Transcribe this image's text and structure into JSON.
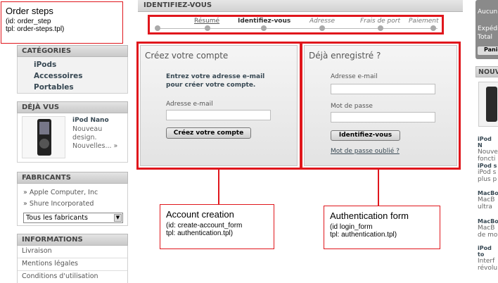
{
  "annotations": {
    "order_steps": {
      "title": "Order steps",
      "line1": "(id: order_step",
      "line2": "tpl: order-steps.tpl)"
    },
    "account_creation": {
      "title": "Account creation",
      "line1": "(id: create-account_form",
      "line2": "tpl: authentication.tpl)"
    },
    "auth_form": {
      "title": "Authentication form",
      "line1": "(id  login_form",
      "line2": "tpl: authentication.tpl)"
    }
  },
  "left": {
    "categories": {
      "title": "CATÉGORIES",
      "items": [
        "iPods",
        "Accessoires",
        "Portables"
      ]
    },
    "viewed": {
      "title": "DÉJÀ VUS",
      "product_name": "iPod Nano",
      "line1": "Nouveau",
      "line2": "design.",
      "line3": "Nouvelles... »"
    },
    "manufacturers": {
      "title": "FABRICANTS",
      "items": [
        "Apple Computer, Inc",
        "Shure Incorporated"
      ],
      "select_value": "Tous les fabricants"
    },
    "informations": {
      "title": "INFORMATIONS",
      "items": [
        "Livraison",
        "Mentions légales",
        "Conditions d'utilisation"
      ]
    }
  },
  "main": {
    "page_title": "IDENTIFIEZ-VOUS",
    "steps": [
      "Résumé",
      "Identifiez-vous",
      "Adresse",
      "Frais de port",
      "Paiement"
    ],
    "create": {
      "title": "Créez votre compte",
      "intro": "Entrez votre adresse e-mail pour créer votre compte.",
      "email_label": "Adresse e-mail",
      "button": "Créez votre compte"
    },
    "login": {
      "title": "Déjà enregistré ?",
      "email_label": "Adresse e-mail",
      "password_label": "Mot de passe",
      "button": "Identifiez-vous",
      "forgot": "Mot de passe oublié ?"
    }
  },
  "right": {
    "cart_lines": [
      "Aucun",
      "Expédi",
      "Total"
    ],
    "cart_button": "Panie",
    "news_title": "NOUV",
    "news_items": [
      {
        "name": "iPod N",
        "l1": "Nouve",
        "l2": "foncti"
      },
      {
        "name": "iPod s",
        "l1": "iPod s",
        "l2": "plus p"
      },
      {
        "name": "MacBo",
        "l1": "MacB",
        "l2": "ultra"
      },
      {
        "name": "MacBo",
        "l1": "MacB",
        "l2": "de mo"
      },
      {
        "name": "iPod to",
        "l1": "Interf",
        "l2": "révolu"
      }
    ]
  }
}
